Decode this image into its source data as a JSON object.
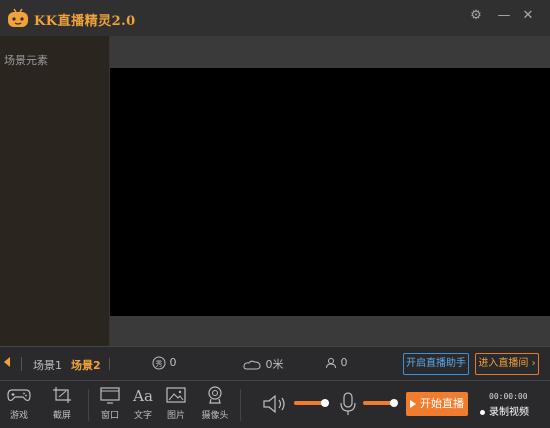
{
  "window": {
    "title": "KK直播精灵2.0",
    "controls": [
      "settings",
      "minimize",
      "close"
    ]
  },
  "scene_panel": {
    "header": "场景元素"
  },
  "scene_bar": {
    "tabs": [
      {
        "label": "场景1",
        "active": false
      },
      {
        "label": "场景2",
        "active": true
      }
    ],
    "stats": {
      "flower_count": "0",
      "sprout_count": "0米",
      "user_count": "0"
    },
    "assist_button": "开启直播助手",
    "room_button": "进入直播间"
  },
  "toolbar": {
    "tools": [
      {
        "label": "游戏",
        "icon": "gamepad-icon"
      },
      {
        "label": "截屏",
        "icon": "crop-icon"
      },
      {
        "label": "窗口",
        "icon": "window-icon"
      },
      {
        "label": "文字",
        "icon": "text-icon"
      },
      {
        "label": "图片",
        "icon": "image-icon"
      },
      {
        "label": "摄像头",
        "icon": "camera-icon"
      }
    ],
    "volume_level": 0.85,
    "mic_level": 0.85,
    "start_button": "开始直播",
    "record_time": "00:00:00",
    "record_label": "录制视频"
  },
  "colors": {
    "accent": "#f2a23a",
    "orange": "#f07d2e",
    "blue": "#3d8fd6",
    "preview_bg": "#000000",
    "panel_bg": "#2b2520"
  }
}
